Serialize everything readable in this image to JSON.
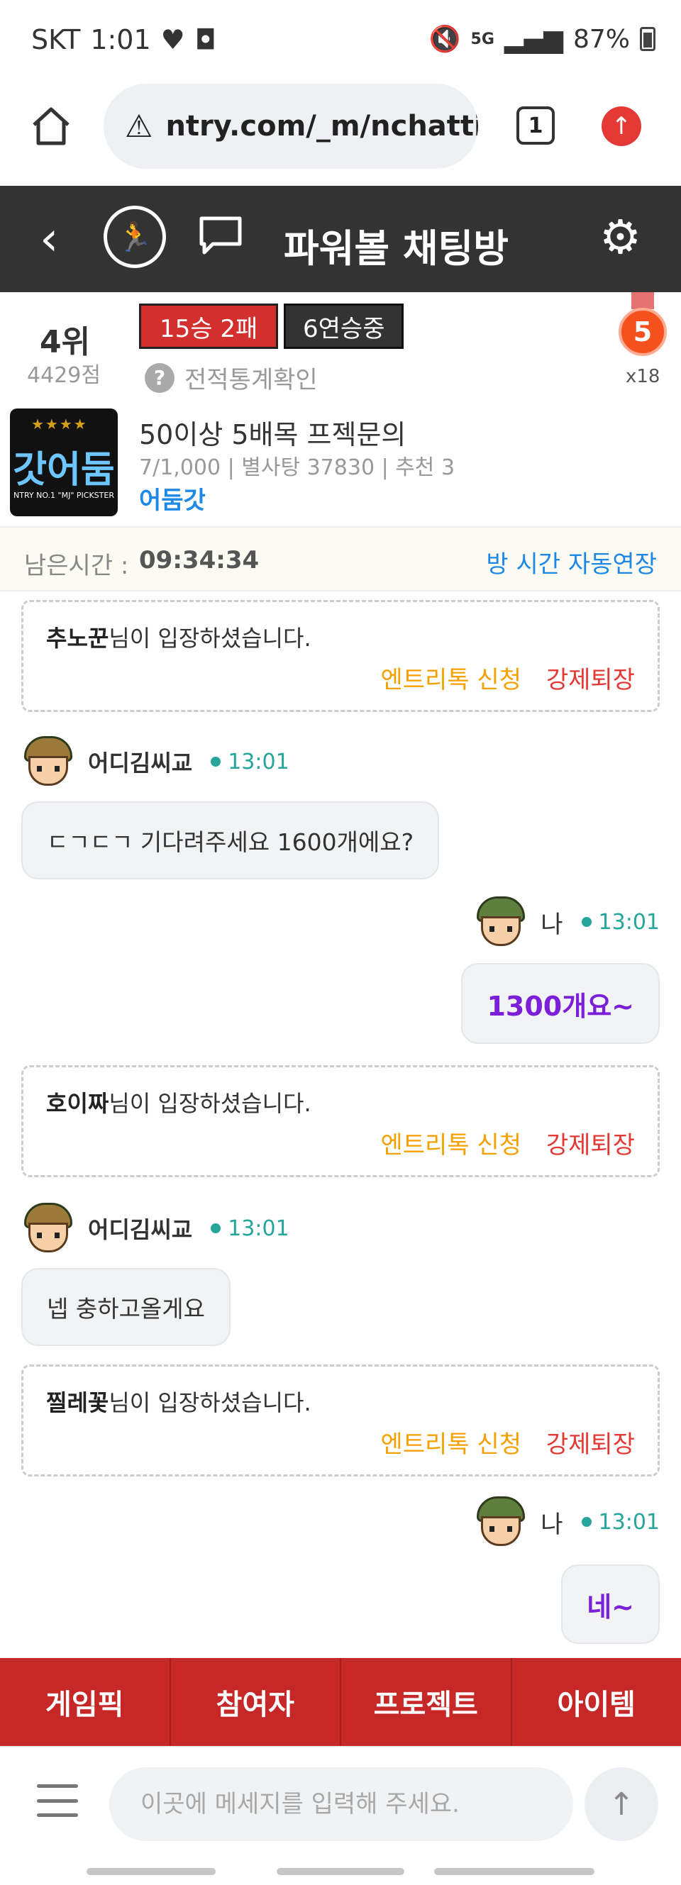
{
  "status_bar": {
    "carrier": "SKT",
    "time": "1:01",
    "network": "5G",
    "battery": "87%"
  },
  "browser": {
    "url": "ntry.com/_m/nchatti",
    "tab_count": "1"
  },
  "header": {
    "title": "파워볼 채팅방"
  },
  "room": {
    "rank": "4위",
    "points": "4429점",
    "record": "15승 2패",
    "streak": "6연승중",
    "stats_link": "전적통계확인",
    "medal_level": "5",
    "medal_count": "x18",
    "name": "50이상 5배목 프젝문의",
    "meta": "7/1,000 | 별사탕 37830 | 추천 3",
    "host": "어둠갓",
    "thumb_text": "갓어둠",
    "thumb_sub": "NTRY NO.1 \"MJ\" PICKSTER"
  },
  "timer": {
    "label": "남은시간 :",
    "value": "09:34:34",
    "auto_extend": "방 시간 자동연장"
  },
  "chat": {
    "notice_suffix": "님이 입장하셨습니다.",
    "entry_label": "엔트리톡 신청",
    "kick_label": "강제퇴장",
    "notices": [
      {
        "user": "추노꾼"
      },
      {
        "user": "호이짜"
      },
      {
        "user": "찔레꽃"
      }
    ],
    "messages": [
      {
        "sender": "어디김씨교",
        "time": "13:01",
        "text": "ㄷㄱㄷㄱ 기다려주세요 1600개에요?"
      },
      {
        "sender": "나",
        "time": "13:01",
        "text": "1300개요~"
      },
      {
        "sender": "어디김씨교",
        "time": "13:01",
        "text": "넵 충하고올게요"
      },
      {
        "sender": "나",
        "time": "13:01",
        "text": "네~"
      }
    ]
  },
  "tabs": [
    "게임픽",
    "참여자",
    "프로젝트",
    "아이템"
  ],
  "input": {
    "placeholder": "이곳에 메세지를 입력해 주세요."
  }
}
